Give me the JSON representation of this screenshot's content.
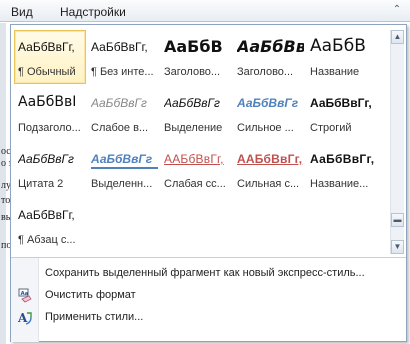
{
  "ribbon": {
    "tabs": [
      {
        "label": "Вид"
      },
      {
        "label": "Надстройки"
      }
    ],
    "collapse_glyph": "⌃"
  },
  "document": {
    "snippets": [
      "ост",
      "о э",
      "лук",
      "то",
      "вы",
      "по"
    ]
  },
  "gallery": {
    "styles": [
      {
        "sample": "АаБбВвГг,",
        "label": "¶ Обычный",
        "selected": true
      },
      {
        "sample": "АаБбВвГг,",
        "label": "¶ Без инте..."
      },
      {
        "sample": "АаБбВ",
        "label": "Заголово..."
      },
      {
        "sample": "АаБбВв",
        "label": "Заголово..."
      },
      {
        "sample": "АаБбВ",
        "label": "Название"
      },
      {
        "sample": "АаБбВвІ",
        "label": "Подзаголо..."
      },
      {
        "sample": "АаБбВвГг",
        "label": "Слабое в..."
      },
      {
        "sample": "АаБбВвГг",
        "label": "Выделение"
      },
      {
        "sample": "АаБбВвГг",
        "label": "Сильное ..."
      },
      {
        "sample": "АаБбВвГг,",
        "label": "Строгий"
      },
      {
        "sample": "АаБбВвГг",
        "label": "Цитата 2"
      },
      {
        "sample": "АаБбВвГг",
        "label": "Выделенн..."
      },
      {
        "sample": "ААБбВвГг,",
        "label": "Слабая сс..."
      },
      {
        "sample": "ААБбВвГг,",
        "label": "Сильная с..."
      },
      {
        "sample": "АаБбВвГг,",
        "label": "Название..."
      },
      {
        "sample": "АаБбВвГг,",
        "label": "¶ Абзац с..."
      }
    ],
    "scroll_up_glyph": "▲",
    "scroll_down_glyph": "▼",
    "expand_glyph": "▬"
  },
  "menu": {
    "save_label": "Сохранить выделенный фрагмент как новый экспресс-стиль...",
    "clear_label": "Очистить формат",
    "apply_label": "Применить стили..."
  },
  "colors": {
    "accent_blue": "#4f81bd",
    "accent_red": "#c0504d",
    "selection_border": "#e9c45a"
  }
}
